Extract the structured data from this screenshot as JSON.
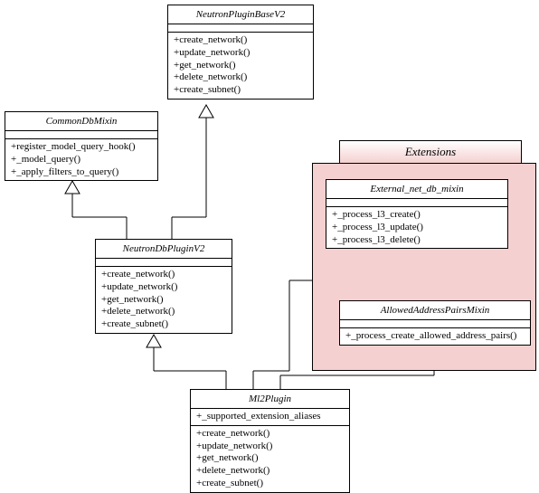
{
  "classes": {
    "neutronPluginBaseV2": {
      "name": "NeutronPluginBaseV2",
      "methods": [
        "+create_network()",
        "+update_network()",
        "+get_network()",
        "+delete_network()",
        "+create_subnet()"
      ]
    },
    "commonDbMixin": {
      "name": "CommonDbMixin",
      "methods": [
        "+register_model_query_hook()",
        "+_model_query()",
        "+_apply_filters_to_query()"
      ]
    },
    "neutronDbPluginV2": {
      "name": "NeutronDbPluginV2",
      "methods": [
        "+create_network()",
        "+update_network()",
        "+get_network()",
        "+delete_network()",
        "+create_subnet()"
      ]
    },
    "externalNetDbMixin": {
      "name": "External_net_db_mixin",
      "methods": [
        "+_process_l3_create()",
        "+_process_l3_update()",
        "+_process_l3_delete()"
      ]
    },
    "allowedAddressPairsMixin": {
      "name": "AllowedAddressPairsMixin",
      "methods": [
        "+_process_create_allowed_address_pairs()"
      ]
    },
    "ml2Plugin": {
      "name": "Ml2Plugin",
      "attributes": [
        "+_supported_extension_aliases"
      ],
      "methods": [
        "+create_network()",
        "+update_network()",
        "+get_network()",
        "+delete_network()",
        "+create_subnet()"
      ]
    }
  },
  "package": {
    "name": "Extensions"
  },
  "relationships": [
    {
      "from": "NeutronDbPluginV2",
      "to": "CommonDbMixin",
      "type": "generalization"
    },
    {
      "from": "NeutronDbPluginV2",
      "to": "NeutronPluginBaseV2",
      "type": "generalization"
    },
    {
      "from": "Ml2Plugin",
      "to": "NeutronDbPluginV2",
      "type": "generalization"
    },
    {
      "from": "Ml2Plugin",
      "to": "External_net_db_mixin",
      "type": "generalization"
    },
    {
      "from": "Ml2Plugin",
      "to": "AllowedAddressPairsMixin",
      "type": "generalization"
    }
  ],
  "chart_data": {
    "type": "uml-class-diagram",
    "classes": [
      "NeutronPluginBaseV2",
      "CommonDbMixin",
      "NeutronDbPluginV2",
      "External_net_db_mixin",
      "AllowedAddressPairsMixin",
      "Ml2Plugin"
    ],
    "package": "Extensions",
    "generalizations": [
      [
        "NeutronDbPluginV2",
        "CommonDbMixin"
      ],
      [
        "NeutronDbPluginV2",
        "NeutronPluginBaseV2"
      ],
      [
        "Ml2Plugin",
        "NeutronDbPluginV2"
      ],
      [
        "Ml2Plugin",
        "External_net_db_mixin"
      ],
      [
        "Ml2Plugin",
        "AllowedAddressPairsMixin"
      ]
    ]
  }
}
